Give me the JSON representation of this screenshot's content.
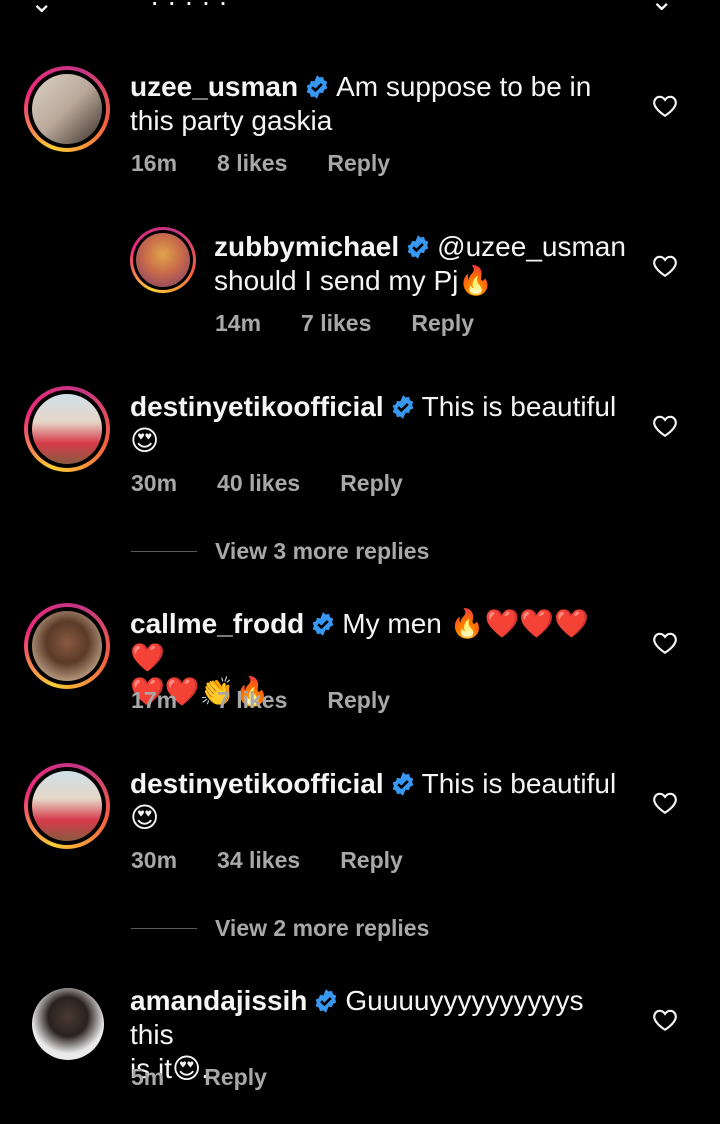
{
  "header": {
    "partial_text": "· ·  ·  ·   ·"
  },
  "comments": [
    {
      "username": "uzee_usman",
      "text_line1": "Am suppose to be in",
      "text_line2": "this party gaskia",
      "time": "16m",
      "likes": "8 likes",
      "reply": "Reply",
      "avatar_colors": [
        "#d9d2c6",
        "#3a2f2a"
      ]
    },
    {
      "username": "zubbymichael",
      "text_line1": "@uzee_usman",
      "text_line2": "should I send my Pj🔥",
      "time": "14m",
      "likes": "7 likes",
      "reply": "Reply",
      "avatar_colors": [
        "#e0a44a",
        "#7a3a6a"
      ]
    },
    {
      "username": "destinyetikoofficial",
      "text_line1": "This is beautiful",
      "text_line2": "😍",
      "time": "30m",
      "likes": "40 likes",
      "reply": "Reply",
      "view_more": "View 3 more replies",
      "avatar_colors": [
        "#e6d6c8",
        "#d63b4a"
      ]
    },
    {
      "username": "callme_frodd",
      "text_line1": "My men 🔥❤️❤️❤️❤️",
      "text_line2": "❤️❤️👏🔥",
      "time": "17m",
      "likes": "7 likes",
      "reply": "Reply",
      "avatar_colors": [
        "#b89a80",
        "#5a3a28"
      ]
    },
    {
      "username": "destinyetikoofficial",
      "text_line1": "This is beautiful",
      "text_line2": "😍",
      "time": "30m",
      "likes": "34 likes",
      "reply": "Reply",
      "view_more": "View 2 more replies",
      "avatar_colors": [
        "#e6d6c8",
        "#d63b4a"
      ]
    },
    {
      "username": "amandajissih",
      "text_line1": "Guuuuyyyyyyyyyys this",
      "text_line2": "is it😍.",
      "time": "5m",
      "reply": "Reply",
      "avatar_colors": [
        "#e8e8e8",
        "#2a2220"
      ]
    }
  ],
  "colors": {
    "verified": "#3897f0",
    "meta": "#a8a8a8",
    "background": "#000000"
  }
}
